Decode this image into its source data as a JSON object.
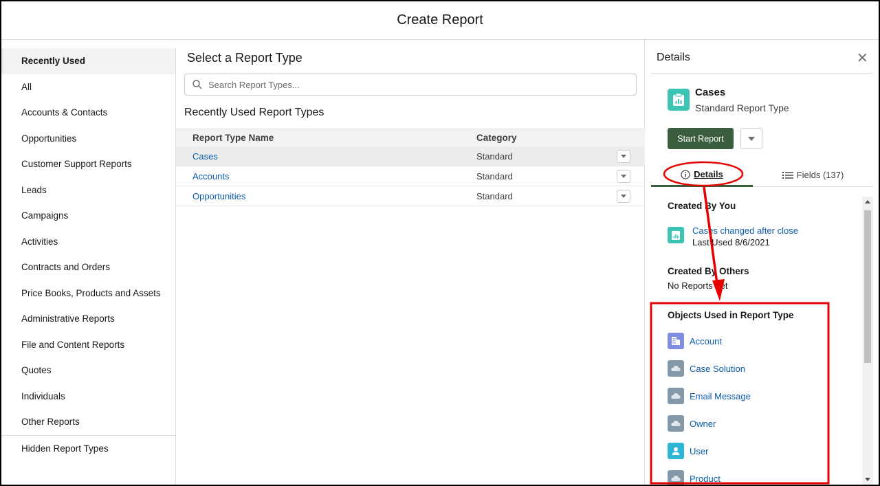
{
  "header": {
    "title": "Create Report"
  },
  "sidebar": {
    "items": [
      {
        "label": "Recently Used"
      },
      {
        "label": "All"
      },
      {
        "label": "Accounts & Contacts"
      },
      {
        "label": "Opportunities"
      },
      {
        "label": "Customer Support Reports"
      },
      {
        "label": "Leads"
      },
      {
        "label": "Campaigns"
      },
      {
        "label": "Activities"
      },
      {
        "label": "Contracts and Orders"
      },
      {
        "label": "Price Books, Products and Assets"
      },
      {
        "label": "Administrative Reports"
      },
      {
        "label": "File and Content Reports"
      },
      {
        "label": "Quotes"
      },
      {
        "label": "Individuals"
      },
      {
        "label": "Other Reports"
      }
    ],
    "hidden": {
      "label": "Hidden Report Types"
    }
  },
  "main": {
    "title": "Select a Report Type",
    "search": {
      "placeholder": "Search Report Types..."
    },
    "section": "Recently Used Report Types",
    "table": {
      "headers": {
        "name": "Report Type Name",
        "category": "Category"
      },
      "rows": [
        {
          "name": "Cases",
          "category": "Standard"
        },
        {
          "name": "Accounts",
          "category": "Standard"
        },
        {
          "name": "Opportunities",
          "category": "Standard"
        }
      ]
    }
  },
  "details": {
    "title": "Details",
    "close_icon": "close-icon",
    "type": {
      "name": "Cases",
      "subtitle": "Standard Report Type"
    },
    "start_button": "Start Report",
    "tabs": {
      "details": "Details",
      "fields": "Fields (137)"
    },
    "created_by_you": {
      "heading": "Created By You",
      "report": {
        "name": "Cases changed after close",
        "last_used": "Last Used 8/6/2021"
      }
    },
    "created_by_others": {
      "heading": "Created By Others",
      "text": "No Reports Yet"
    },
    "objects": {
      "heading": "Objects Used in Report Type",
      "items": [
        {
          "label": "Account",
          "icon": "account-icon"
        },
        {
          "label": "Case Solution",
          "icon": "custom-object-icon"
        },
        {
          "label": "Email Message",
          "icon": "custom-object-icon"
        },
        {
          "label": "Owner",
          "icon": "custom-object-icon"
        },
        {
          "label": "User",
          "icon": "user-icon"
        },
        {
          "label": "Product",
          "icon": "custom-object-icon"
        }
      ]
    }
  },
  "colors": {
    "brand_button": "#3b5e3e",
    "link": "#0b5cab",
    "annotation": "#e60000"
  }
}
